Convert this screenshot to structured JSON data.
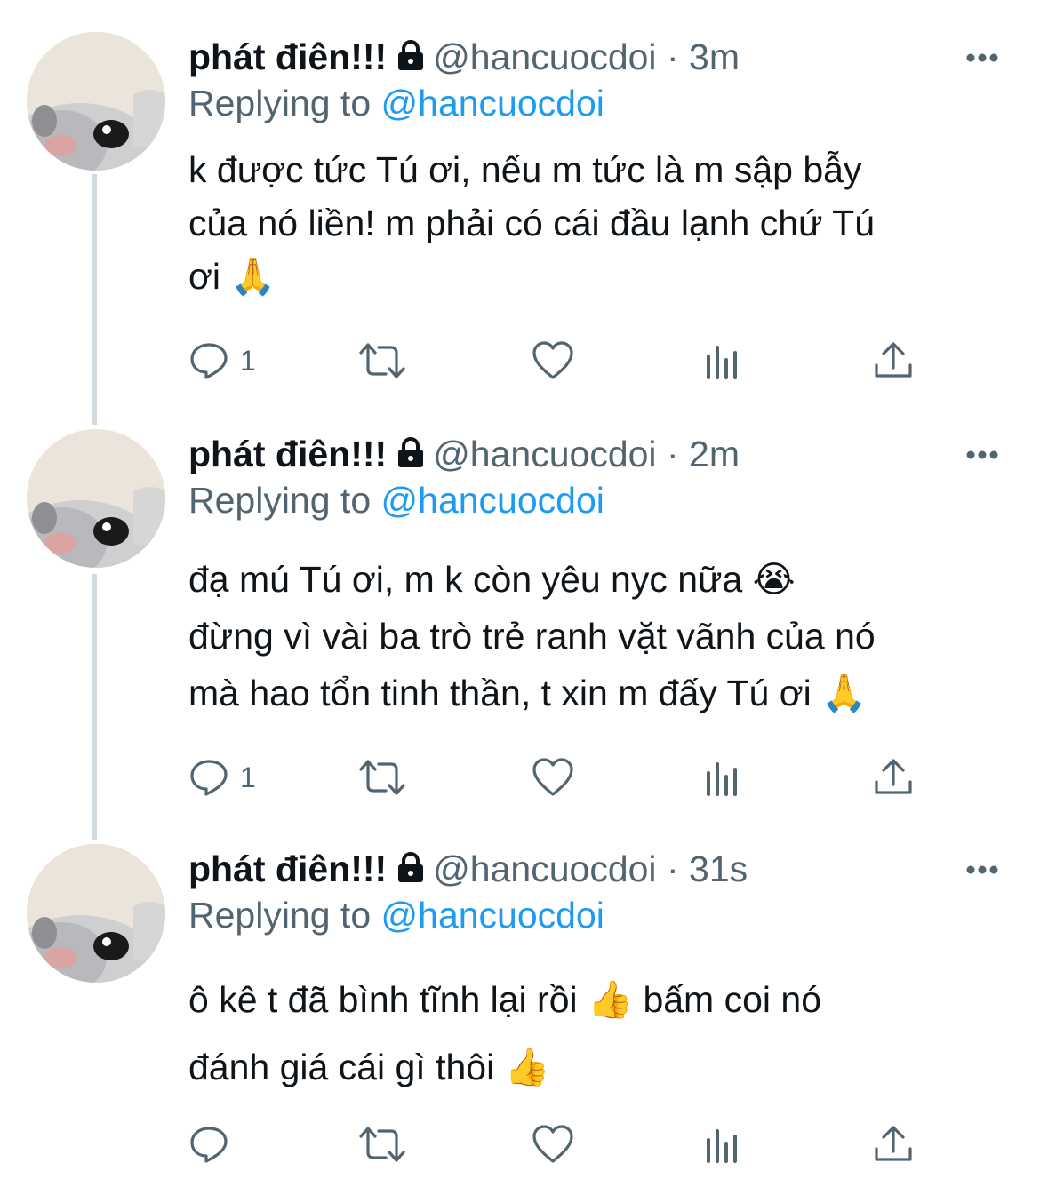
{
  "tweets": [
    {
      "display_name": "phát điên!!!",
      "handle": "@hancuocdoi",
      "separator": "·",
      "time": "3m",
      "replying_label": "Replying to",
      "replying_to": "@hancuocdoi",
      "text_lines": [
        "k được tức Tú ơi, nếu m tức là m sập bẫy",
        "của nó liền! m phải có cái đầu lạnh chứ Tú",
        "ơi 🙏"
      ],
      "reply_count": "1"
    },
    {
      "display_name": "phát điên!!!",
      "handle": "@hancuocdoi",
      "separator": "·",
      "time": "2m",
      "replying_label": "Replying to",
      "replying_to": "@hancuocdoi",
      "text_lines": [
        "đạ mú Tú ơi, m k còn yêu nyc nữa 😭",
        "đừng vì vài ba trò trẻ ranh vặt vãnh của nó",
        "mà hao tổn tinh thần, t xin m đấy Tú ơi 🙏"
      ],
      "reply_count": "1"
    },
    {
      "display_name": "phát điên!!!",
      "handle": "@hancuocdoi",
      "separator": "·",
      "time": "31s",
      "replying_label": "Replying to",
      "replying_to": "@hancuocdoi",
      "text_lines": [
        "ô kê t đã bình tĩnh lại rồi 👍  bấm coi nó",
        "đánh giá cái gì thôi 👍"
      ],
      "reply_count": ""
    }
  ],
  "icons": {
    "lock": "lock-icon",
    "more": "more-icon",
    "reply": "reply-icon",
    "retweet": "retweet-icon",
    "like": "like-icon",
    "analytics": "analytics-icon",
    "share": "share-icon"
  },
  "colors": {
    "text": "#0f1419",
    "secondary": "#536471",
    "link": "#1d9bf0",
    "thread_line": "#cfd9de"
  }
}
